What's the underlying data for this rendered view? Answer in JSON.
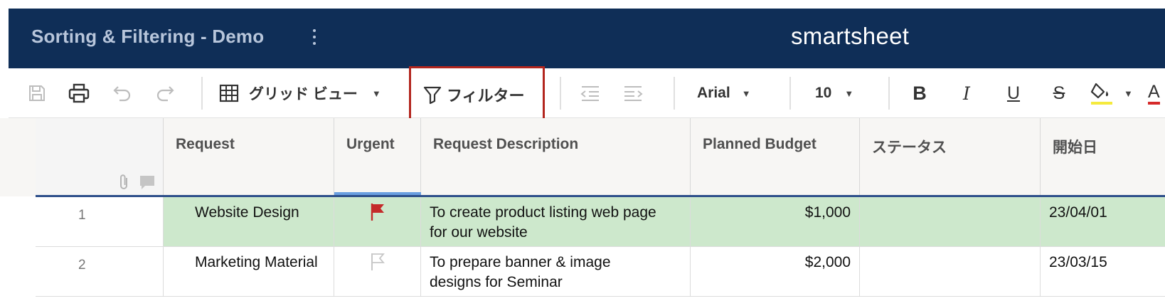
{
  "header": {
    "sheet_title": "Sorting & Filtering - Demo",
    "logo_text": "smartsheet",
    "background_color": "#0f2e57"
  },
  "toolbar": {
    "icons": [
      "save-icon",
      "print-icon",
      "undo-icon",
      "redo-icon",
      "grid-icon",
      "filter-icon",
      "outdent-icon",
      "indent-icon",
      "bold-icon",
      "italic-icon",
      "underline-icon",
      "strikethrough-icon",
      "fill-color-icon",
      "text-color-icon"
    ],
    "view_label": "グリッド ビュー",
    "filter_label": "フィルター",
    "font_family_value": "Arial",
    "font_size_value": "10",
    "bold_label": "B",
    "italic_label": "I",
    "underline_label": "U",
    "strike_label": "S",
    "text_color_label": "A",
    "filter_highlight_color": "#b3261e"
  },
  "columns": {
    "request": "Request",
    "urgent": "Urgent",
    "description": "Request Description",
    "budget": "Planned Budget",
    "status": "ステータス",
    "start_date": "開始日"
  },
  "rows": [
    {
      "number": "1",
      "request": "Website Design",
      "urgent": true,
      "description_line1": "To create product listing web page",
      "description_line2": "for our website",
      "budget": "$1,000",
      "status": "",
      "start_date": "23/04/01",
      "highlight_color": "#cde8cc"
    },
    {
      "number": "2",
      "request": "Marketing Material",
      "urgent": false,
      "description_line1": "To prepare banner & image",
      "description_line2": "designs for Seminar",
      "budget": "$2,000",
      "status": "",
      "start_date": "23/03/15"
    }
  ]
}
